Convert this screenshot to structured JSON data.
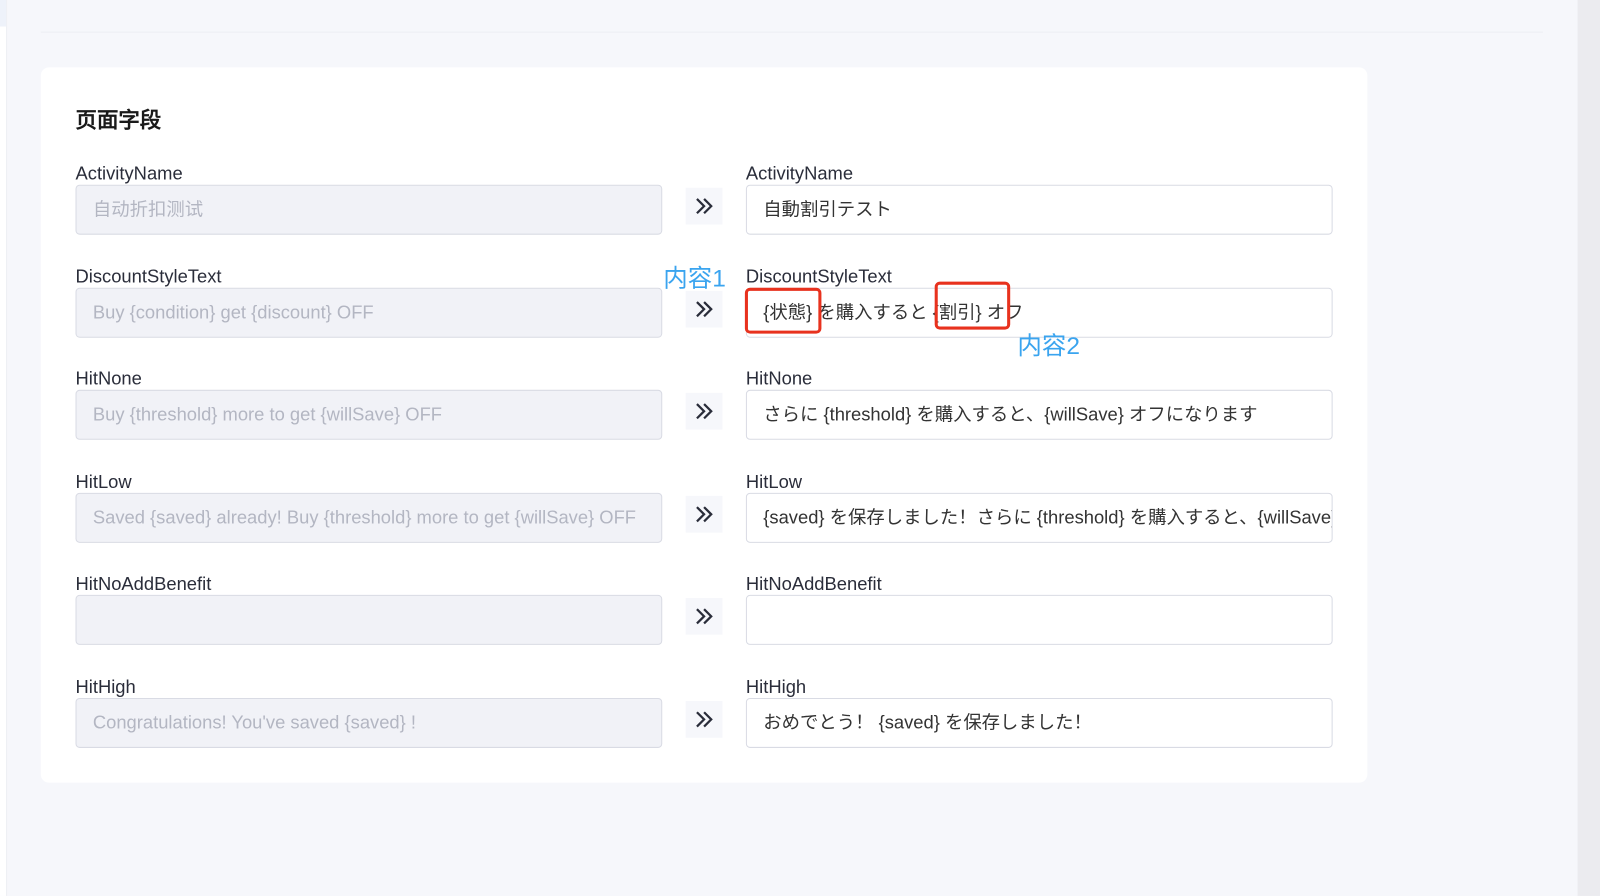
{
  "section_title": "页面字段",
  "fields": [
    {
      "label": "ActivityName",
      "source_value": "自动折扣测试",
      "target_value": "自動割引テスト"
    },
    {
      "label": "DiscountStyleText",
      "source_value": "Buy {condition} get {discount} OFF",
      "target_value": "{状態} を購入すると {割引} オフ"
    },
    {
      "label": "HitNone",
      "source_value": "Buy {threshold} more to get {willSave} OFF",
      "target_value": "さらに {threshold} を購入すると、{willSave} オフになります"
    },
    {
      "label": "HitLow",
      "source_value": "Saved {saved} already! Buy {threshold} more to get {willSave} OFF",
      "target_value": "{saved} を保存しました！さらに {threshold} を購入すると、{willSave} オフになります"
    },
    {
      "label": "HitNoAddBenefit",
      "source_value": "",
      "target_value": ""
    },
    {
      "label": "HitHigh",
      "source_value": "Congratulations! You've saved {saved} !",
      "target_value": "おめでとう！ {saved} を保存しました！"
    }
  ],
  "annotations": {
    "content1": "内容1",
    "content2": "内容2"
  },
  "colors": {
    "annotation": "#3aa4ef",
    "highlight_box": "#e8321e"
  }
}
